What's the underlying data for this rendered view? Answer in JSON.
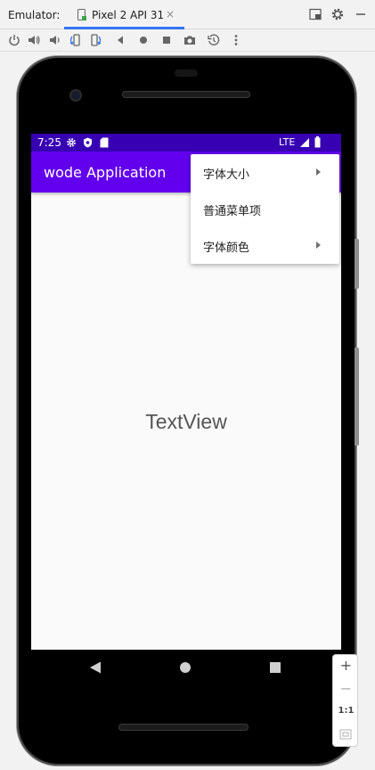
{
  "window": {
    "label": "Emulator:",
    "tab": {
      "label": "Pixel 2 API 31",
      "close_glyph": "×"
    }
  },
  "toolbar_icons": [
    "power-icon",
    "volume-up-icon",
    "volume-down-icon",
    "rotate-left-icon",
    "rotate-right-icon",
    "back-icon",
    "home-icon",
    "overview-icon",
    "screenshot-icon",
    "snapshot-icon",
    "more-icon"
  ],
  "device": {
    "status": {
      "time": "7:25",
      "network": "LTE"
    },
    "app_title": "wode Application",
    "content_text": "TextView",
    "menu": {
      "items": [
        {
          "label": "字体大小",
          "has_submenu": true
        },
        {
          "label": "普通菜单项",
          "has_submenu": false
        },
        {
          "label": "字体颜色",
          "has_submenu": true
        }
      ]
    }
  },
  "zoom": {
    "plus": "+",
    "minus": "−",
    "reset": "1:1"
  },
  "colors": {
    "status_bar": "#3700b3",
    "app_bar": "#6200ee",
    "tab_underline": "#3574f0"
  }
}
